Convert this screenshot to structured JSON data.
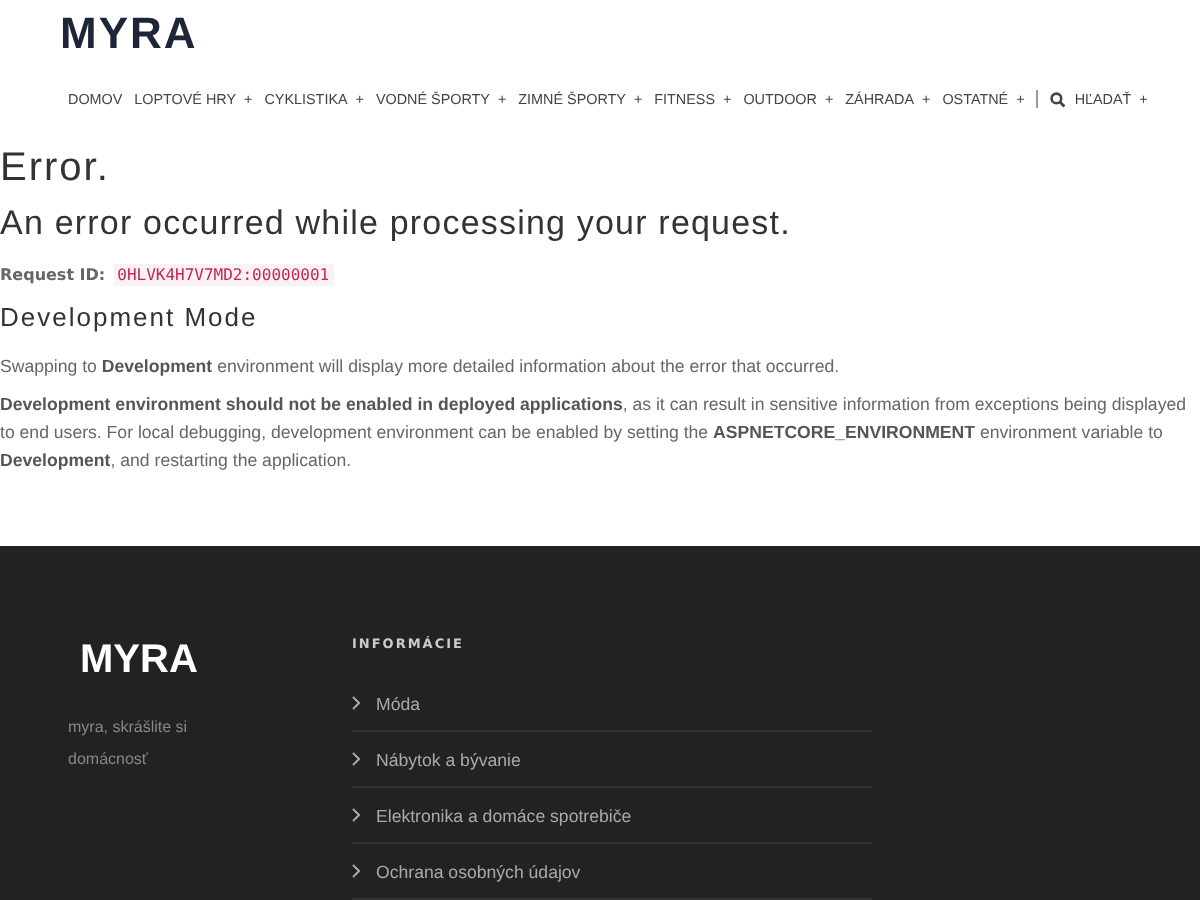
{
  "header": {
    "logo": "MYRA"
  },
  "nav": [
    {
      "label": "DOMOV",
      "plus": false
    },
    {
      "label": "LOPTOVÉ HRY",
      "plus": true
    },
    {
      "label": "CYKLISTIKA",
      "plus": true
    },
    {
      "label": "VODNÉ ŠPORTY",
      "plus": true
    },
    {
      "label": "ZIMNÉ ŠPORTY",
      "plus": true
    },
    {
      "label": "FITNESS",
      "plus": true
    },
    {
      "label": "OUTDOOR",
      "plus": true
    },
    {
      "label": "ZÁHRADA",
      "plus": true
    },
    {
      "label": "OSTATNÉ",
      "plus": true
    }
  ],
  "nav_plus": "+",
  "nav_search": "HĽADAŤ",
  "error": {
    "title": "Error.",
    "subtitle": "An error occurred while processing your request.",
    "request_label": "Request ID:",
    "request_id": "0HLVK4H7V7MD2:00000001",
    "dev_heading": "Development Mode",
    "paragraphs": [
      "Swapping to **Development** environment will display more detailed information about the error that occurred.",
      "**Development environment should not be enabled in deployed applications**, as it can result in sensitive information from exceptions being displayed to end users. For local debugging, development environment can be enabled by setting the **ASPNETCORE_ENVIRONMENT** environment variable to **Development**, and restarting the application."
    ]
  },
  "footer": {
    "logo": "MYRA",
    "tagline": "myra, skrášlite si domácnosť",
    "heading": "INFORMÁCIE",
    "links": [
      "Móda",
      "Nábytok a bývanie",
      "Elektronika a domáce spotrebiče",
      "Ochrana osobných údajov"
    ]
  }
}
